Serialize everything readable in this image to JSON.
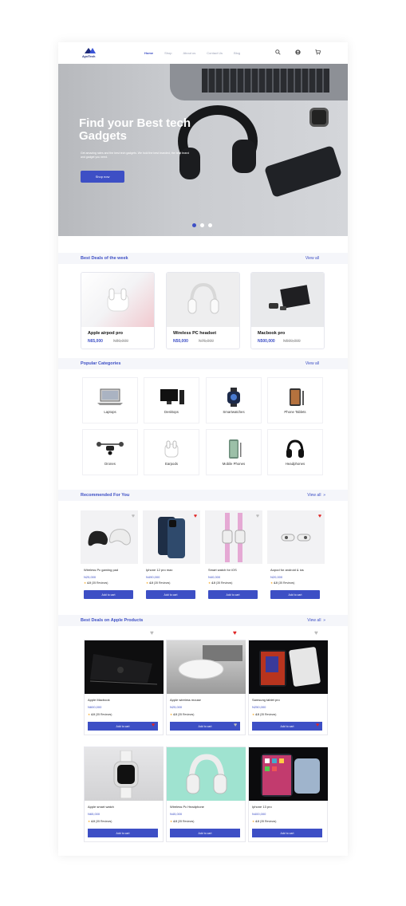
{
  "header": {
    "brand": "AyoTech",
    "menu": [
      "Home",
      "Shop",
      "About us",
      "Contact Us",
      "Blog"
    ],
    "icons": [
      "search-icon",
      "user-icon",
      "cart-icon"
    ]
  },
  "hero": {
    "title": "Find your Best tech Gadgets",
    "subtitle": "Get amazing rates and the best tech gadgets. We hold the best branded, the best brand and gadget you need.",
    "button": "Shop now"
  },
  "best_deals": {
    "title": "Best Deals of the week",
    "view_all": "View all",
    "items": [
      {
        "name": "Apple airpod pro",
        "price": "N65,000",
        "old_price": "N80,000"
      },
      {
        "name": "Wireless PC headset",
        "price": "N50,000",
        "old_price": "N75,000"
      },
      {
        "name": "Macbook pro",
        "price": "N500,000",
        "old_price": "N590,000"
      }
    ]
  },
  "categories": {
    "title": "Popular Categories",
    "view_all": "View all",
    "items": [
      "Laptops",
      "Desktops",
      "Smartwatches",
      "Phone Tablets",
      "Drones",
      "Earpods",
      "Mobile Phones",
      "Headphones"
    ]
  },
  "recommended": {
    "title": "Recommended For You",
    "view_all": "View all",
    "view_all_arrow": "»",
    "items": [
      {
        "name": "Wireless Pc gaming pad",
        "price": "N25,000",
        "rating": "4.0",
        "reviews": "(35 Reviews)",
        "button": "Add to cart"
      },
      {
        "name": "Iphone 12 pro max",
        "price": "N490,000",
        "rating": "4.0",
        "reviews": "(35 Reviews)",
        "button": "Add to cart"
      },
      {
        "name": "Smart watch for iOS",
        "price": "N40,000",
        "rating": "4.0",
        "reviews": "(35 Reviews)",
        "button": "Add to cart"
      },
      {
        "name": "Aopod for android & ios",
        "price": "N20,000",
        "rating": "4.0",
        "reviews": "(35 Reviews)",
        "button": "Add to cart"
      }
    ]
  },
  "apple": {
    "title": "Best Deals on Apple Products",
    "view_all": "View all",
    "view_all_arrow": "»",
    "items": [
      {
        "name": "Apple Macbook",
        "price": "N600,000",
        "rating": "4.0",
        "reviews": "(35 Reviews)",
        "button": "Add to cart"
      },
      {
        "name": "Apple wireless mouse",
        "price": "N25,000",
        "rating": "4.0",
        "reviews": "(35 Reviews)",
        "button": "Add to cart"
      },
      {
        "name": "Samsung tablet pro",
        "price": "N250,000",
        "rating": "4.0",
        "reviews": "(35 Reviews)",
        "button": "Add to cart"
      },
      {
        "name": "Apple smart watch",
        "price": "N65,000",
        "rating": "4.0",
        "reviews": "(35 Reviews)",
        "button": "Add to cart"
      },
      {
        "name": "Wireless Pc Headphone",
        "price": "N45,000",
        "rating": "4.0",
        "reviews": "(35 Reviews)",
        "button": "Add to cart"
      },
      {
        "name": "Iphone 13 pro",
        "price": "N400,000",
        "rating": "4.0",
        "reviews": "(35 Reviews)",
        "button": "Add to cart"
      }
    ]
  },
  "colors": {
    "accent": "#3d4fc5",
    "heart_active": "#e02424",
    "heart_inactive": "#bbbbbb",
    "star": "#f5a623"
  }
}
